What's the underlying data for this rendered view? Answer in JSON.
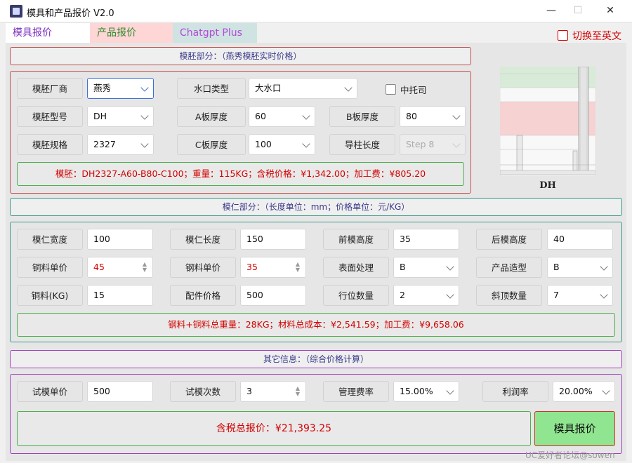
{
  "window": {
    "title": "模具和产品报价 V2.0",
    "minimize": "—",
    "maximize": "☐",
    "close": "✕"
  },
  "tabs": [
    "模具报价",
    "产品报价",
    "Chatgpt Plus"
  ],
  "lang_toggle": {
    "label": "切换至英文",
    "checked": false
  },
  "base_section": {
    "header": "模胚部分：（燕秀模胚实时价格）",
    "labels": {
      "maker": "模胚厂商",
      "gate": "水口类型",
      "middle_plate": "中托司",
      "model": "模胚型号",
      "a_plate": "A板厚度",
      "b_plate": "B板厚度",
      "spec": "模胚规格",
      "c_plate": "C板厚度",
      "guide": "导柱长度"
    },
    "values": {
      "maker": "燕秀",
      "gate": "大水口",
      "model": "DH",
      "a_plate": "60",
      "b_plate": "80",
      "spec": "2327",
      "c_plate": "100",
      "guide": "Step 8"
    },
    "middle_plate_checked": false,
    "result": "模胚：DH2327-A60-B80-C100；重量：115KG；含税价格：¥1,342.00；加工费：¥805.20",
    "preview_caption": "DH"
  },
  "core_section": {
    "header": "模仁部分：（长度单位：mm；价格单位：元/KG）",
    "labels": {
      "width": "模仁宽度",
      "length": "模仁长度",
      "front_h": "前模高度",
      "rear_h": "后模高度",
      "copper_price": "铜料单价",
      "steel_price": "钢料单价",
      "surface": "表面处理",
      "shape": "产品造型",
      "copper_kg": "铜料(KG)",
      "parts_price": "配件价格",
      "slide_qty": "行位数量",
      "lifter_qty": "斜顶数量"
    },
    "values": {
      "width": "100",
      "length": "150",
      "front_h": "35",
      "rear_h": "40",
      "copper_price": "45",
      "steel_price": "35",
      "surface": "B",
      "shape": "B",
      "copper_kg": "15",
      "parts_price": "500",
      "slide_qty": "2",
      "lifter_qty": "7"
    },
    "result": "钢料+铜料总重量：28KG；材料总成本：¥2,541.59；加工费：¥9,658.06"
  },
  "other_section": {
    "header": "其它信息：（综合价格计算）",
    "labels": {
      "trial_price": "试模单价",
      "trial_count": "试模次数",
      "mgmt_rate": "管理费率",
      "profit_rate": "利润率"
    },
    "values": {
      "trial_price": "500",
      "trial_count": "3",
      "mgmt_rate": "15.00%",
      "profit_rate": "20.00%"
    },
    "total": "含税总报价：¥21,393.25",
    "quote_button": "模具报价"
  },
  "watermark": "UC爱好者论坛@sowen",
  "colors": {
    "base_border": "#c0504d",
    "core_border": "#3a9a8a",
    "other_border": "#a040c0",
    "result_border": "#4caf50",
    "red_text": "#d40000"
  }
}
